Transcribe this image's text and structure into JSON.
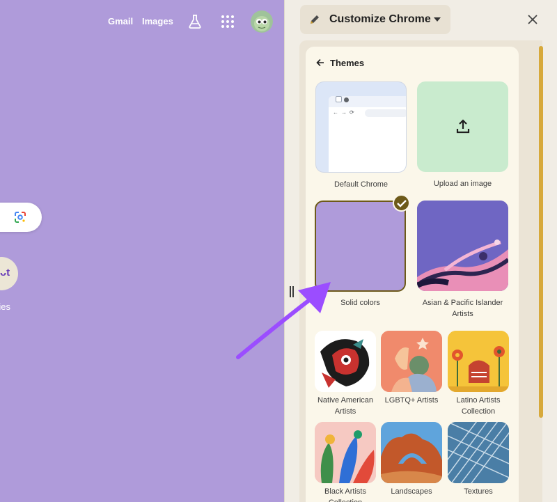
{
  "ntp": {
    "gmail_label": "Gmail",
    "images_label": "Images",
    "shortcut_label": "ries",
    "shortcut_glyph": "ᴗt",
    "background_color": "#af9bda"
  },
  "panel": {
    "title": "Customize Chrome",
    "back_label": "Themes"
  },
  "themes": [
    {
      "id": "default",
      "label": "Default Chrome"
    },
    {
      "id": "upload",
      "label": "Upload an image"
    },
    {
      "id": "solid",
      "label": "Solid colors",
      "selected": true
    },
    {
      "id": "asian",
      "label": "Asian & Pacific Islander Artists"
    },
    {
      "id": "native",
      "label": "Native American Artists"
    },
    {
      "id": "lgbtq",
      "label": "LGBTQ+ Artists"
    },
    {
      "id": "latino",
      "label": "Latino Artists Collection"
    },
    {
      "id": "black",
      "label": "Black Artists Collection"
    },
    {
      "id": "landscapes",
      "label": "Landscapes"
    },
    {
      "id": "textures",
      "label": "Textures"
    }
  ],
  "colors": {
    "accent": "#6d5a1a",
    "scrollbar": "#d7a93b",
    "annotation_arrow": "#9b4dff"
  },
  "icons": [
    "labs-icon",
    "apps-grid-icon",
    "avatar",
    "lens-icon",
    "pencil-icon",
    "caret-down-icon",
    "close-icon",
    "back-arrow-icon",
    "upload-icon",
    "checkmark-icon"
  ]
}
